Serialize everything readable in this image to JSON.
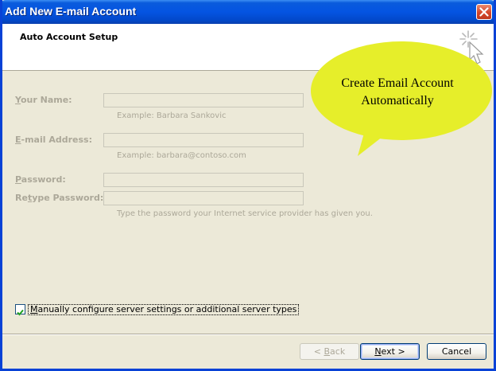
{
  "window": {
    "title": "Add New E-mail Account",
    "close_icon": "close-icon"
  },
  "header": {
    "title": "Auto Account Setup",
    "icon": "wand-icon"
  },
  "callout": {
    "line1": "Create Email Account",
    "line2": "Automatically",
    "color": "#e6ee2a"
  },
  "form": {
    "name": {
      "label_u": "Y",
      "label_rest": "our Name:",
      "value": "",
      "hint": "Example: Barbara Sankovic"
    },
    "email": {
      "label_u": "E",
      "label_rest": "-mail Address:",
      "value": "",
      "hint": "Example: barbara@contoso.com"
    },
    "password": {
      "label_u": "P",
      "label_rest": "assword:",
      "value": ""
    },
    "retype": {
      "label_pre": "Re",
      "label_u": "t",
      "label_rest": "ype Password:",
      "value": ""
    },
    "password_hint": "Type the password your Internet service provider has given you."
  },
  "manual_config": {
    "checked": true,
    "label_u": "M",
    "label_rest": "anually configure server settings or additional server types"
  },
  "buttons": {
    "back": {
      "pre": "< ",
      "u": "B",
      "rest": "ack"
    },
    "next": {
      "u": "N",
      "rest": "ext >"
    },
    "cancel": "Cancel"
  }
}
